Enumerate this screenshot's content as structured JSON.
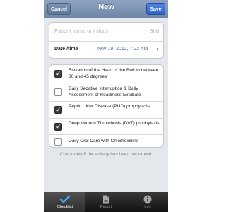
{
  "navbar": {
    "title": "New",
    "cancel_label": "Cancel",
    "save_label": "Save"
  },
  "patient": {
    "name_placeholder": "Patient name or initials",
    "bed_placeholder": "Bed"
  },
  "datetime": {
    "label": "Date /time",
    "value": "Nov 19, 2012, 7:22 AM"
  },
  "checklist": {
    "items": [
      {
        "label": "Elevation of the Head of the Bed to between 30 and 45 degrees",
        "checked": true
      },
      {
        "label": "Daily Sedative Interruption & Daily Assessment of Readiness Extubate",
        "checked": false
      },
      {
        "label": "Peptic Ulcer Disease (PUD) prophylaxis",
        "checked": true
      },
      {
        "label": "Deep Venous Thrombosis (DVT) prophylaxis",
        "checked": true
      },
      {
        "label": "Daily Oral Care with Chlorhexidine",
        "checked": false
      }
    ],
    "footnote": "Check only if the activity has been performed."
  },
  "tabbar": {
    "tabs": [
      {
        "label": "Checklist",
        "icon": "checkmark-icon",
        "active": true
      },
      {
        "label": "Report",
        "icon": "document-icon",
        "active": false
      },
      {
        "label": "Info",
        "icon": "info-icon",
        "active": false
      }
    ]
  },
  "colors": {
    "navbar": "#7b91b1",
    "save": "#3a6fd6",
    "datetime_value": "#4c6da0",
    "background": "#e4e7ec"
  }
}
